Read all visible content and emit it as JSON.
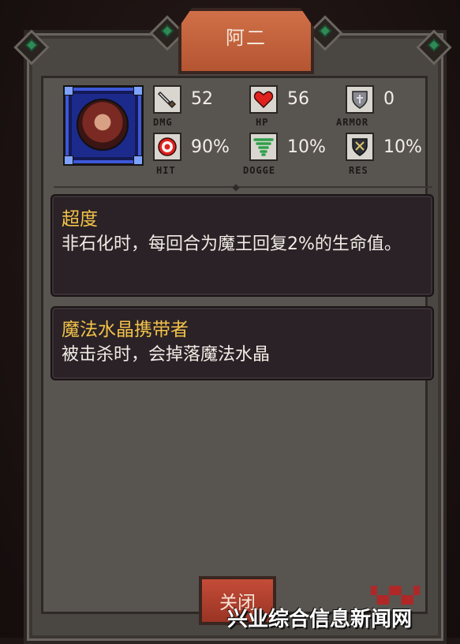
{
  "window": {
    "title": "阿二"
  },
  "stats": [
    {
      "id": "dmg",
      "icon": "sword-icon",
      "value": "52",
      "label": "DMG"
    },
    {
      "id": "hp",
      "icon": "heart-icon",
      "value": "56",
      "label": "HP"
    },
    {
      "id": "armor",
      "icon": "shield-icon",
      "value": "0",
      "label": "ARMOR"
    },
    {
      "id": "hit",
      "icon": "target-icon",
      "value": "90%",
      "label": "HIT"
    },
    {
      "id": "dodge",
      "icon": "tornado-icon",
      "value": "10%",
      "label": "DOGGE"
    },
    {
      "id": "res",
      "icon": "resist-shield-icon",
      "value": "10%",
      "label": "RES"
    }
  ],
  "skills": [
    {
      "name": "超度",
      "desc": "非石化时，每回合为魔王回复2%的生命值。"
    },
    {
      "name": "魔法水晶携带者",
      "desc": "被击杀时，会掉落魔法水晶"
    }
  ],
  "footer": {
    "close_label": "关闭"
  },
  "watermark": {
    "text": "兴业综合信息新闻网"
  },
  "colors": {
    "skill_title": "#f2c24a",
    "title_tab": "#c8643c",
    "panel": "#585450"
  }
}
